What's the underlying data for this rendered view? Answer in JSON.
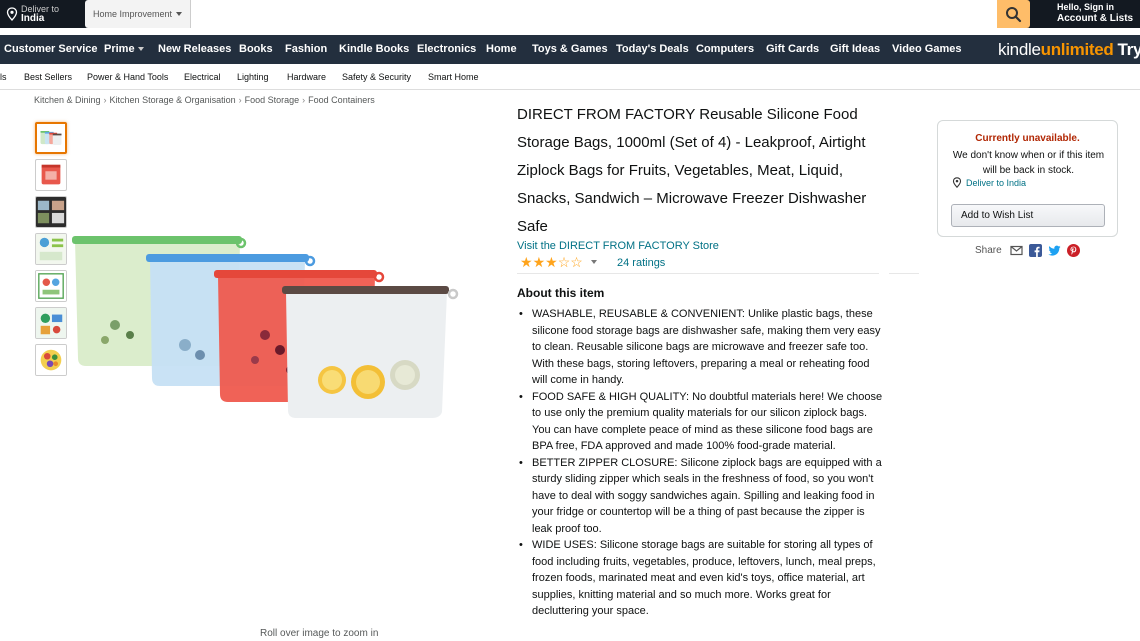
{
  "header": {
    "deliver_line1": "Deliver to",
    "deliver_line2": "India",
    "search_department": "Home Improvement",
    "search_placeholder": "",
    "search_icon": "search-icon",
    "account_line1": "Hello, Sign in",
    "account_line2": "Account & Lists"
  },
  "main_nav": {
    "items": [
      {
        "label": "Customer Service"
      },
      {
        "label": "Prime",
        "dropdown": true
      },
      {
        "label": "New Releases"
      },
      {
        "label": "Books"
      },
      {
        "label": "Fashion"
      },
      {
        "label": "Kindle Books"
      },
      {
        "label": "Electronics"
      },
      {
        "label": "Home"
      },
      {
        "label": "Toys & Games"
      },
      {
        "label": "Today's Deals"
      },
      {
        "label": "Computers"
      },
      {
        "label": "Gift Cards"
      },
      {
        "label": "Gift Ideas"
      },
      {
        "label": "Video Games"
      }
    ],
    "kindle_part1": "kindle",
    "kindle_part2": "unlimited",
    "kindle_part3": "Try y"
  },
  "sub_nav": {
    "items": [
      {
        "label": "ls"
      },
      {
        "label": "Best Sellers"
      },
      {
        "label": "Power & Hand Tools"
      },
      {
        "label": "Electrical"
      },
      {
        "label": "Lighting"
      },
      {
        "label": "Hardware"
      },
      {
        "label": "Safety & Security"
      },
      {
        "label": "Smart Home"
      }
    ]
  },
  "breadcrumb": {
    "items": [
      "Kitchen & Dining",
      "Kitchen Storage & Organisation",
      "Food Storage",
      "Food Containers"
    ],
    "separator": "›"
  },
  "gallery": {
    "thumbnail_count": 7,
    "selected_index": 0,
    "zoom_hint": "Roll over image to zoom in"
  },
  "product": {
    "title": "DIRECT FROM FACTORY Reusable Silicone Food Storage Bags, 1000ml (Set of 4) - Leakproof, Airtight Ziplock Bags for Fruits, Vegetables, Meat, Liquid, Snacks, Sandwich – Microwave Freezer Dishwasher Safe",
    "store_link": "Visit the DIRECT FROM FACTORY Store",
    "rating_stars": 3,
    "rating_max": 5,
    "ratings_count": "24 ratings",
    "about_heading": "About this item",
    "bullets": [
      "WASHABLE, REUSABLE & CONVENIENT: Unlike plastic bags, these silicone food storage bags are dishwasher safe, making them very easy to clean. Reusable silicone bags are microwave and freezer safe too. With these bags, storing leftovers, preparing a meal or reheating food will come in handy.",
      "FOOD SAFE & HIGH QUALITY: No doubtful materials here! We choose to use only the premium quality materials for our silicon ziplock bags. You can have complete peace of mind as these silicone food bags are BPA free, FDA approved and made 100% food-grade material.",
      "BETTER ZIPPER CLOSURE: Silicone ziplock bags are equipped with a sturdy sliding zipper which seals in the freshness of food, so you won't have to deal with soggy sandwiches again. Spilling and leaking food in your fridge or countertop will be a thing of past because the zipper is leak proof too.",
      "WIDE USES: Silicone storage bags are suitable for storing all types of food including fruits, vegetables, produce, leftovers, lunch, meal preps, frozen foods, marinated meat and even kid's toys, office material, art supplies, knitting material and so much more. Works great for decluttering your space."
    ]
  },
  "buybox": {
    "unavailable_title": "Currently unavailable.",
    "unavailable_message": "We don't know when or if this item will be back in stock.",
    "deliver_to": "Deliver to India",
    "wishlist_button": "Add to Wish List",
    "share_label": "Share"
  },
  "colors": {
    "nav_top": "#131921",
    "nav_main": "#232f3e",
    "search_button": "#febd69",
    "link": "#007185",
    "unavailable": "#b12704",
    "star": "#ffa41c",
    "kindle_orange": "#f79400"
  }
}
